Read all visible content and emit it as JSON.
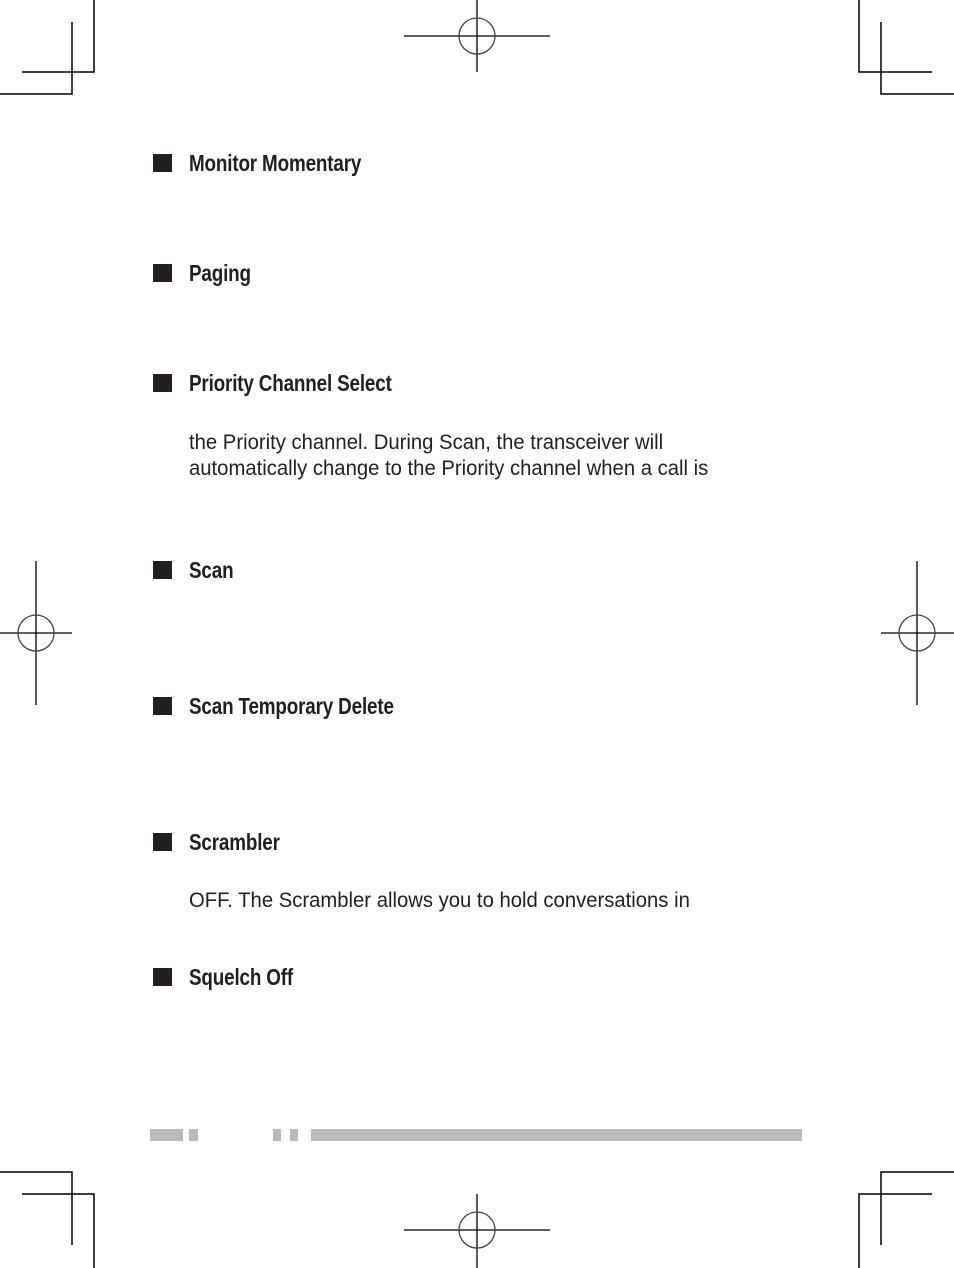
{
  "sections": [
    {
      "heading": "Monitor Momentary",
      "body": []
    },
    {
      "heading": "Paging",
      "body": []
    },
    {
      "heading": "Priority Channel Select",
      "body": [
        "the Priority channel.  During Scan, the transceiver will",
        "automatically change to the Priority channel when a call is"
      ]
    },
    {
      "heading": "Scan",
      "body": []
    },
    {
      "heading": "Scan Temporary Delete",
      "body": []
    },
    {
      "heading": "Scrambler",
      "body": [
        "OFF.  The Scrambler allows you to hold conversations in"
      ]
    },
    {
      "heading": "Squelch Off",
      "body": []
    }
  ],
  "footer": {
    "bar_color": "#bbbbbb"
  },
  "colors": {
    "text": "#231f20",
    "marks": "#000000"
  }
}
